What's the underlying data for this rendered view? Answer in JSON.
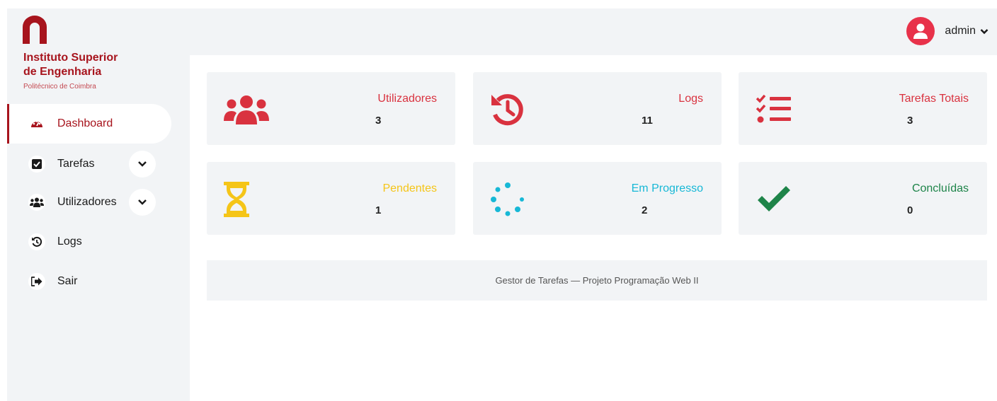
{
  "brand": {
    "line1": "Instituto Superior",
    "line2": "de Engenharia",
    "subtitle": "Politécnico de Coimbra",
    "color": "#a7141d"
  },
  "sidebar": {
    "items": [
      {
        "label": "Dashboard",
        "icon": "speedometer-icon",
        "active": true
      },
      {
        "label": "Tarefas",
        "icon": "checkbox-icon",
        "expandable": true
      },
      {
        "label": "Utilizadores",
        "icon": "users-icon",
        "expandable": true
      },
      {
        "label": "Logs",
        "icon": "history-icon"
      },
      {
        "label": "Sair",
        "icon": "sign-out-icon"
      }
    ]
  },
  "header": {
    "username": "admin",
    "avatar_icon": "user-avatar-icon",
    "avatar_color": "#e8324a"
  },
  "cards": [
    {
      "label": "Utilizadores",
      "value": "3",
      "icon": "users-icon",
      "color": "#d9323f"
    },
    {
      "label": "Logs",
      "value": "11",
      "icon": "history-icon",
      "color": "#d9323f"
    },
    {
      "label": "Tarefas Totais",
      "value": "3",
      "icon": "task-list-icon",
      "color": "#d9323f"
    },
    {
      "label": "Pendentes",
      "value": "1",
      "icon": "hourglass-icon",
      "color": "#f5c518"
    },
    {
      "label": "Em Progresso",
      "value": "2",
      "icon": "spinner-icon",
      "color": "#17b8d6"
    },
    {
      "label": "Concluídas",
      "value": "0",
      "icon": "check-icon",
      "color": "#1e8449"
    }
  ],
  "footer": {
    "text": "Gestor de Tarefas — Projeto Programação Web II"
  }
}
